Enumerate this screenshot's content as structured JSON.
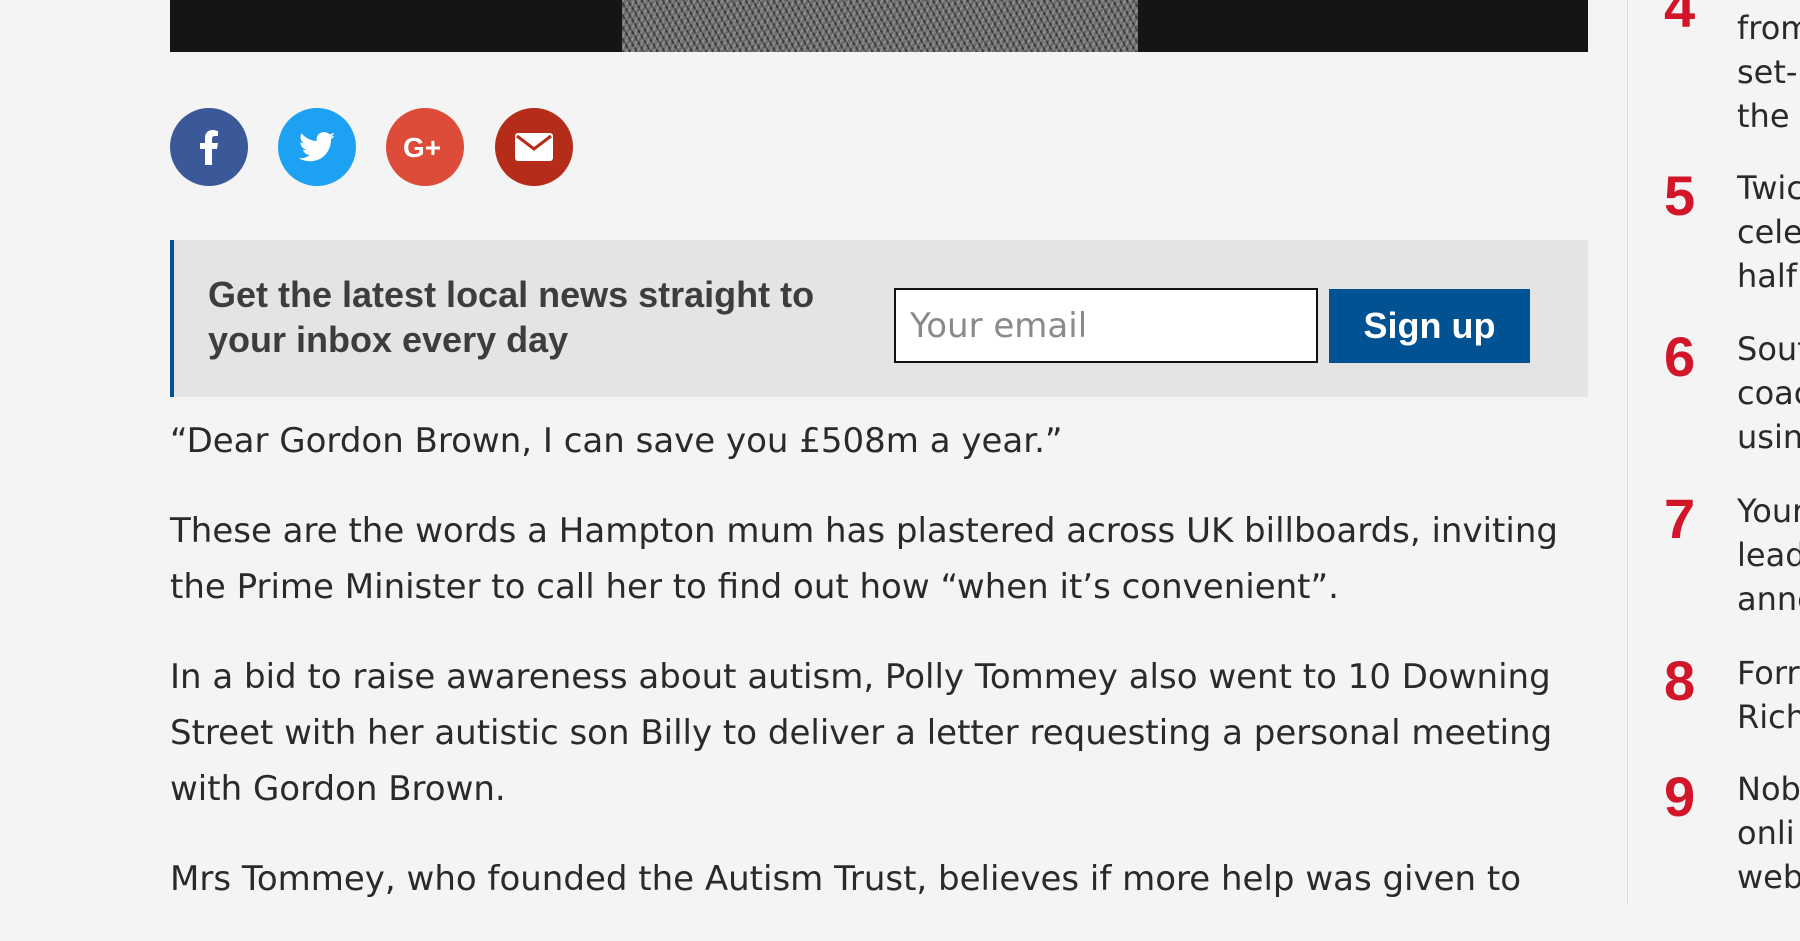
{
  "share": {
    "buttons": [
      {
        "network": "facebook",
        "icon": "facebook-icon",
        "color": "#3b5998"
      },
      {
        "network": "twitter",
        "icon": "twitter-icon",
        "color": "#1da1f2"
      },
      {
        "network": "google-plus",
        "icon": "google-plus-icon",
        "label": "G+",
        "color": "#dd4b39"
      },
      {
        "network": "email",
        "icon": "envelope-icon",
        "color": "#b52c1a"
      }
    ]
  },
  "newsletter": {
    "heading_line1": "Get the latest local news straight to",
    "heading_line2": "your inbox every day",
    "email_placeholder": "Your email",
    "signup_label": "Sign up",
    "accent_color": "#005293"
  },
  "article": {
    "paragraphs": [
      "“Dear Gordon Brown, I can save you £508m a year.”",
      "These are the words a Hampton mum has plastered across UK billboards, inviting the Prime Minister to call her to find out how “when it’s convenient”.",
      "In a bid to raise awareness about autism, Polly Tommey also went to 10 Downing Street with her autistic son Billy to deliver a letter requesting a personal meeting with Gordon Brown.",
      "Mrs Tommey, who founded the Autism Trust, believes if more help was given to"
    ]
  },
  "sidebar": {
    "accent_color": "#d3152a",
    "items": [
      {
        "number": "4",
        "lines": [
          "from",
          "set-",
          "the"
        ]
      },
      {
        "number": "5",
        "lines": [
          "Twic",
          "cele",
          "half"
        ]
      },
      {
        "number": "6",
        "lines": [
          "Sout",
          "coac",
          "usin"
        ]
      },
      {
        "number": "7",
        "lines": [
          "Your",
          "lead",
          "anne"
        ]
      },
      {
        "number": "8",
        "lines": [
          "Forr",
          "Rich"
        ]
      },
      {
        "number": "9",
        "lines": [
          "Nob",
          "onli",
          "web"
        ]
      }
    ]
  }
}
